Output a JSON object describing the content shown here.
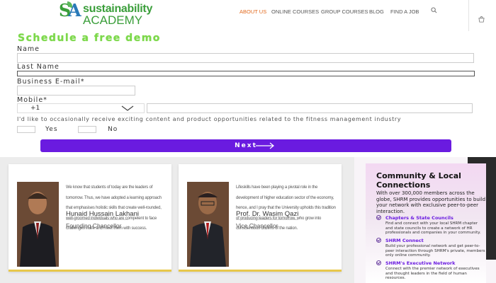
{
  "brand": {
    "name_line1": "sustainability",
    "name_line2": "ACADEMY"
  },
  "nav": {
    "items": [
      "ABOUT US",
      "ONLINE COURSES",
      "GROUP COURSES",
      "BLOG",
      "FIND A JOB"
    ],
    "active": "ABOUT US"
  },
  "colors": {
    "accent": "#e26a1e",
    "brand_green": "#3a9e3a",
    "button": "#6a1be0",
    "title_green": "#7cd84a"
  },
  "form": {
    "title": "Schedule a free demo",
    "labels": {
      "name": "Name",
      "last_name": "Last Name",
      "email": "Business E-mail*",
      "mobile": "Mobile*"
    },
    "country_code": "+1",
    "consent": "I'd like to occasionally receive exciting content and product opportunities related to the fitness management industry",
    "yes_label": "Yes",
    "no_label": "No",
    "submit_label": "Next"
  },
  "leaders": [
    {
      "quote": "We know that students of today are the leaders of tomorrow. Thus, we have adopted a learning approach that emphasises holistic skills that create well-rounded, well-groomed individuals who are competent to face challenges in life and meet them with success.",
      "name": "Hunaid Hussain Lakhani",
      "role": "Founding Chancellor"
    },
    {
      "quote": "Lifeskills have been playing a pivotal role in the development of higher education sector of the economy, hence, and I pray that the University upholds this tradition of producing leaders for tomorrow, who grow into conscientious citizens of the nation.",
      "name": "Prof. Dr. Wasim Qazi",
      "role": "Vice Chancellor"
    }
  ],
  "community": {
    "title": "Community & Local Connections",
    "intro": "With over 300,000 members across the globe, SHRM provides opportunities to build your network with exclusive peer-to-peer interaction.",
    "features": [
      {
        "title": "Chapters & State Councils",
        "desc": "Find and connect with your local SHRM chapter and state councils to create a network of HR professionals and companies in your community."
      },
      {
        "title": "SHRM Connect",
        "desc": "Build your professional network and get peer-to-peer interaction through SHRM's private, members only online community."
      },
      {
        "title": "SHRM's Executive Network",
        "desc": "Connect with the premier network of executives and thought leaders in the field of human resources."
      }
    ]
  }
}
